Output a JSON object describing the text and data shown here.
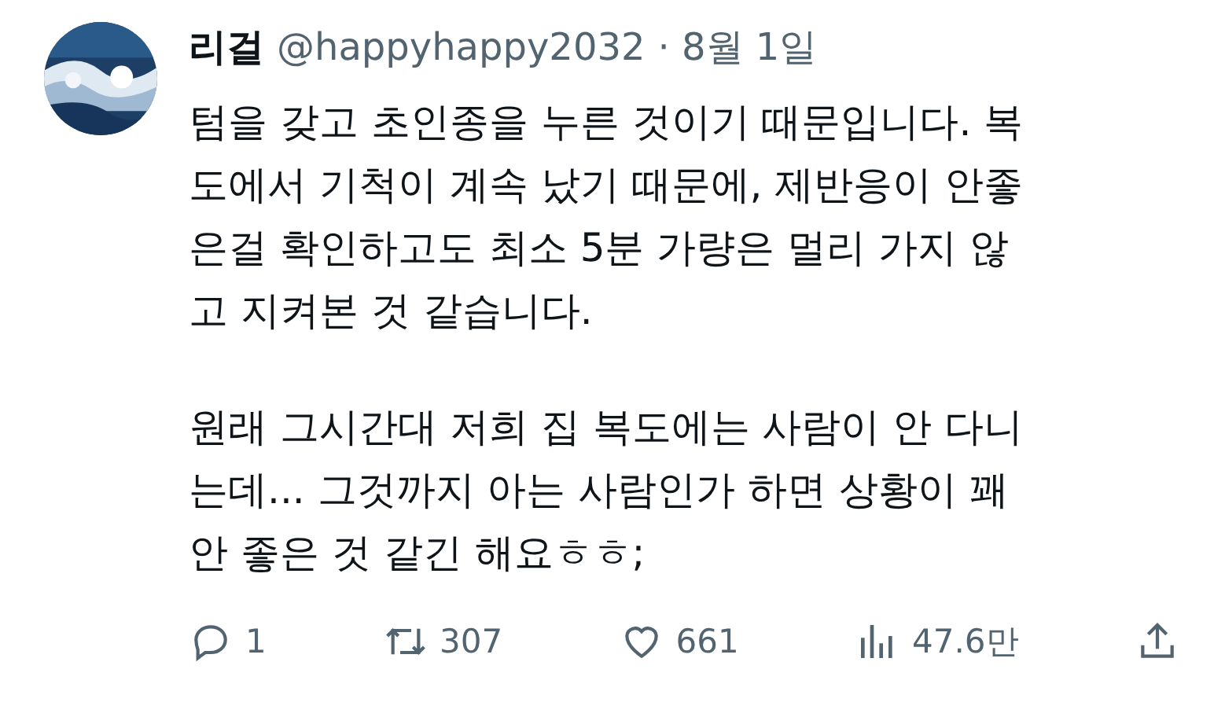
{
  "tweet": {
    "author": {
      "name": "리걸",
      "handle": "@happyhappy2032",
      "date": "· 8월 1일"
    },
    "paragraphs": [
      "텀을 갖고 초인종을 누른 것이기 때문입니다. 복\n도에서 기척이 계속 났기 때문에, 제반응이 안좋\n은걸 확인하고도 최소 5분 가량은 멀리 가지 않\n고 지켜본 것 같습니다.",
      "원래 그시간대 저희 집 복도에는 사람이 안 다니\n는데... 그것까지 아는 사람인가 하면 상황이 꽤\n안 좋은 것 같긴 해요ㅎㅎ;"
    ],
    "actions": [
      {
        "kind": "reply",
        "count": "1"
      },
      {
        "kind": "retweet",
        "count": "307"
      },
      {
        "kind": "like",
        "count": "661"
      },
      {
        "kind": "views",
        "count": "47.6만"
      },
      {
        "kind": "share"
      }
    ]
  }
}
